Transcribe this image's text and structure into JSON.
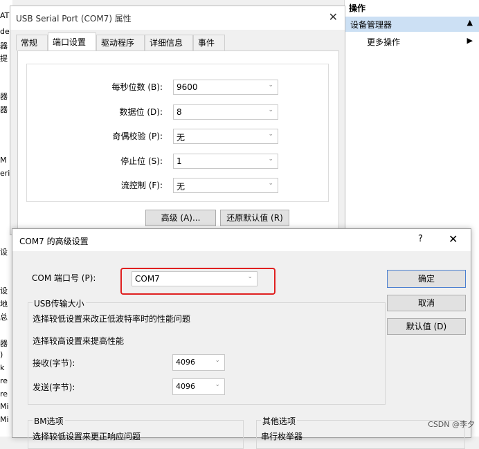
{
  "background": {
    "left_fragments": [
      "AT,",
      "de",
      "器",
      "提",
      "器",
      "器",
      "M",
      "eri",
      "设",
      "设",
      "地",
      "总",
      "器",
      ")",
      "k",
      "re",
      "re",
      "Mi",
      "Mi"
    ]
  },
  "actions_pane": {
    "header": "操作",
    "section": "设备管理器",
    "section_arrow": "▲",
    "more": "更多操作",
    "more_arrow": "▶"
  },
  "props_dialog": {
    "title": "USB Serial Port (COM7) 属性",
    "close": "✕",
    "tabs": [
      "常规",
      "端口设置",
      "驱动程序",
      "详细信息",
      "事件"
    ],
    "fields": [
      {
        "label": "每秒位数 (B):",
        "value": "9600"
      },
      {
        "label": "数据位 (D):",
        "value": "8"
      },
      {
        "label": "奇偶校验 (P):",
        "value": "无"
      },
      {
        "label": "停止位 (S):",
        "value": "1"
      },
      {
        "label": "流控制 (F):",
        "value": "无"
      }
    ],
    "advanced_button": "高级 (A)...",
    "restore_button": "还原默认值 (R)"
  },
  "adv_dialog": {
    "title": "COM7 的高级设置",
    "help": "?",
    "close": "✕",
    "com_label": "COM 端口号 (P):",
    "com_value": "COM7",
    "usb_legend": "USB传输大小",
    "usb_line1": "选择较低设置来改正低波特率时的性能问题",
    "usb_line2": "选择较高设置来提高性能",
    "receive_label": "接收(字节):",
    "receive_value": "4096",
    "send_label": "发送(字节):",
    "send_value": "4096",
    "bm_legend": "BM选项",
    "bm_line1": "选择较低设置来更正响应问题",
    "other_legend": "其他选项",
    "other_line1": "串行枚举器",
    "ok_button": "确定",
    "cancel_button": "取消",
    "default_button": "默认值 (D)"
  },
  "watermark": "CSDN @李夕",
  "icons": {
    "dropdown": "chevron-down-icon"
  }
}
